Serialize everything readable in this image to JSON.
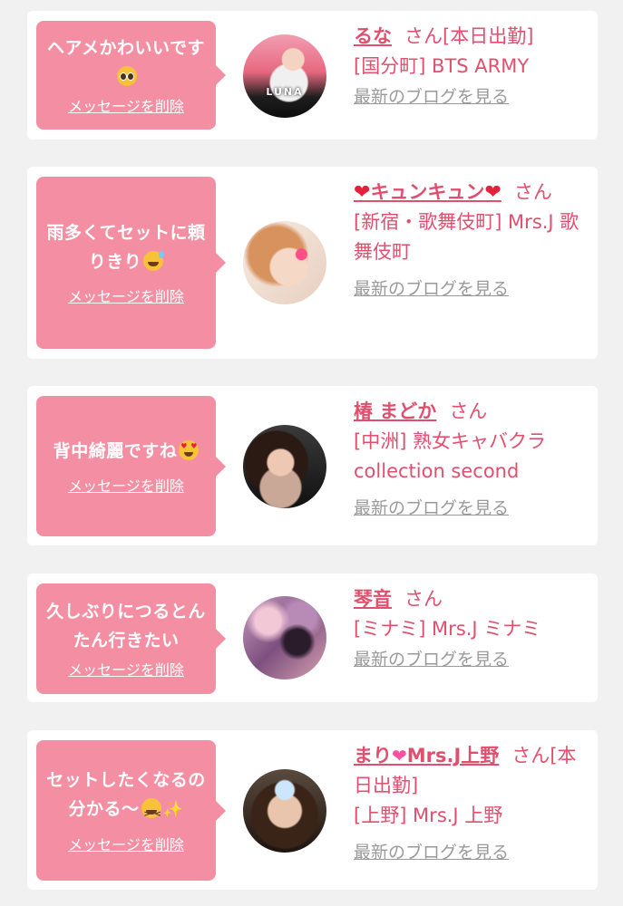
{
  "delete_label": "メッセージを削除",
  "blog_label": "最新のブログを見る",
  "honorific": "さん",
  "cards": [
    {
      "message": "ヘアメかわいいです",
      "message_emoji": "pleading-face-emoji",
      "name": "るな",
      "status": "[本日出勤]",
      "shop": "[国分町] BTS ARMY",
      "avatar_text": "LUNA"
    },
    {
      "message": "雨多くてセットに頼りきり",
      "message_emoji": "grinning-sweat-emoji",
      "name_prefix_icon": "red-heart-icon",
      "name": "キュンキュン",
      "name_suffix_icon": "red-heart-icon",
      "shop": "[新宿・歌舞伎町] Mrs.J 歌舞伎町"
    },
    {
      "message": "背中綺麗ですね",
      "message_emoji": "heart-eyes-emoji",
      "name": "椿 まどか",
      "shop": "[中洲] 熟女キャバクラ collection second"
    },
    {
      "message": "久しぶりにつるとんたん行きたい",
      "name": "琴音",
      "shop": "[ミナミ] Mrs.J ミナミ"
    },
    {
      "message": "セットしたくなるの分かる〜",
      "message_emoji": "squinting-laugh-emoji",
      "message_emoji_2": "sparkles-emoji",
      "name_part_1": "まり",
      "name_icon": "sparkling-heart-icon",
      "name_part_2": "Mrs.J上野",
      "status": "[本日出勤]",
      "shop": "[上野] Mrs.J 上野"
    }
  ],
  "colors": {
    "bubble": "#f48fa3",
    "name": "#e0506e",
    "link_gray": "#9a9a9a",
    "background": "#f1f1f1",
    "card": "#ffffff"
  }
}
